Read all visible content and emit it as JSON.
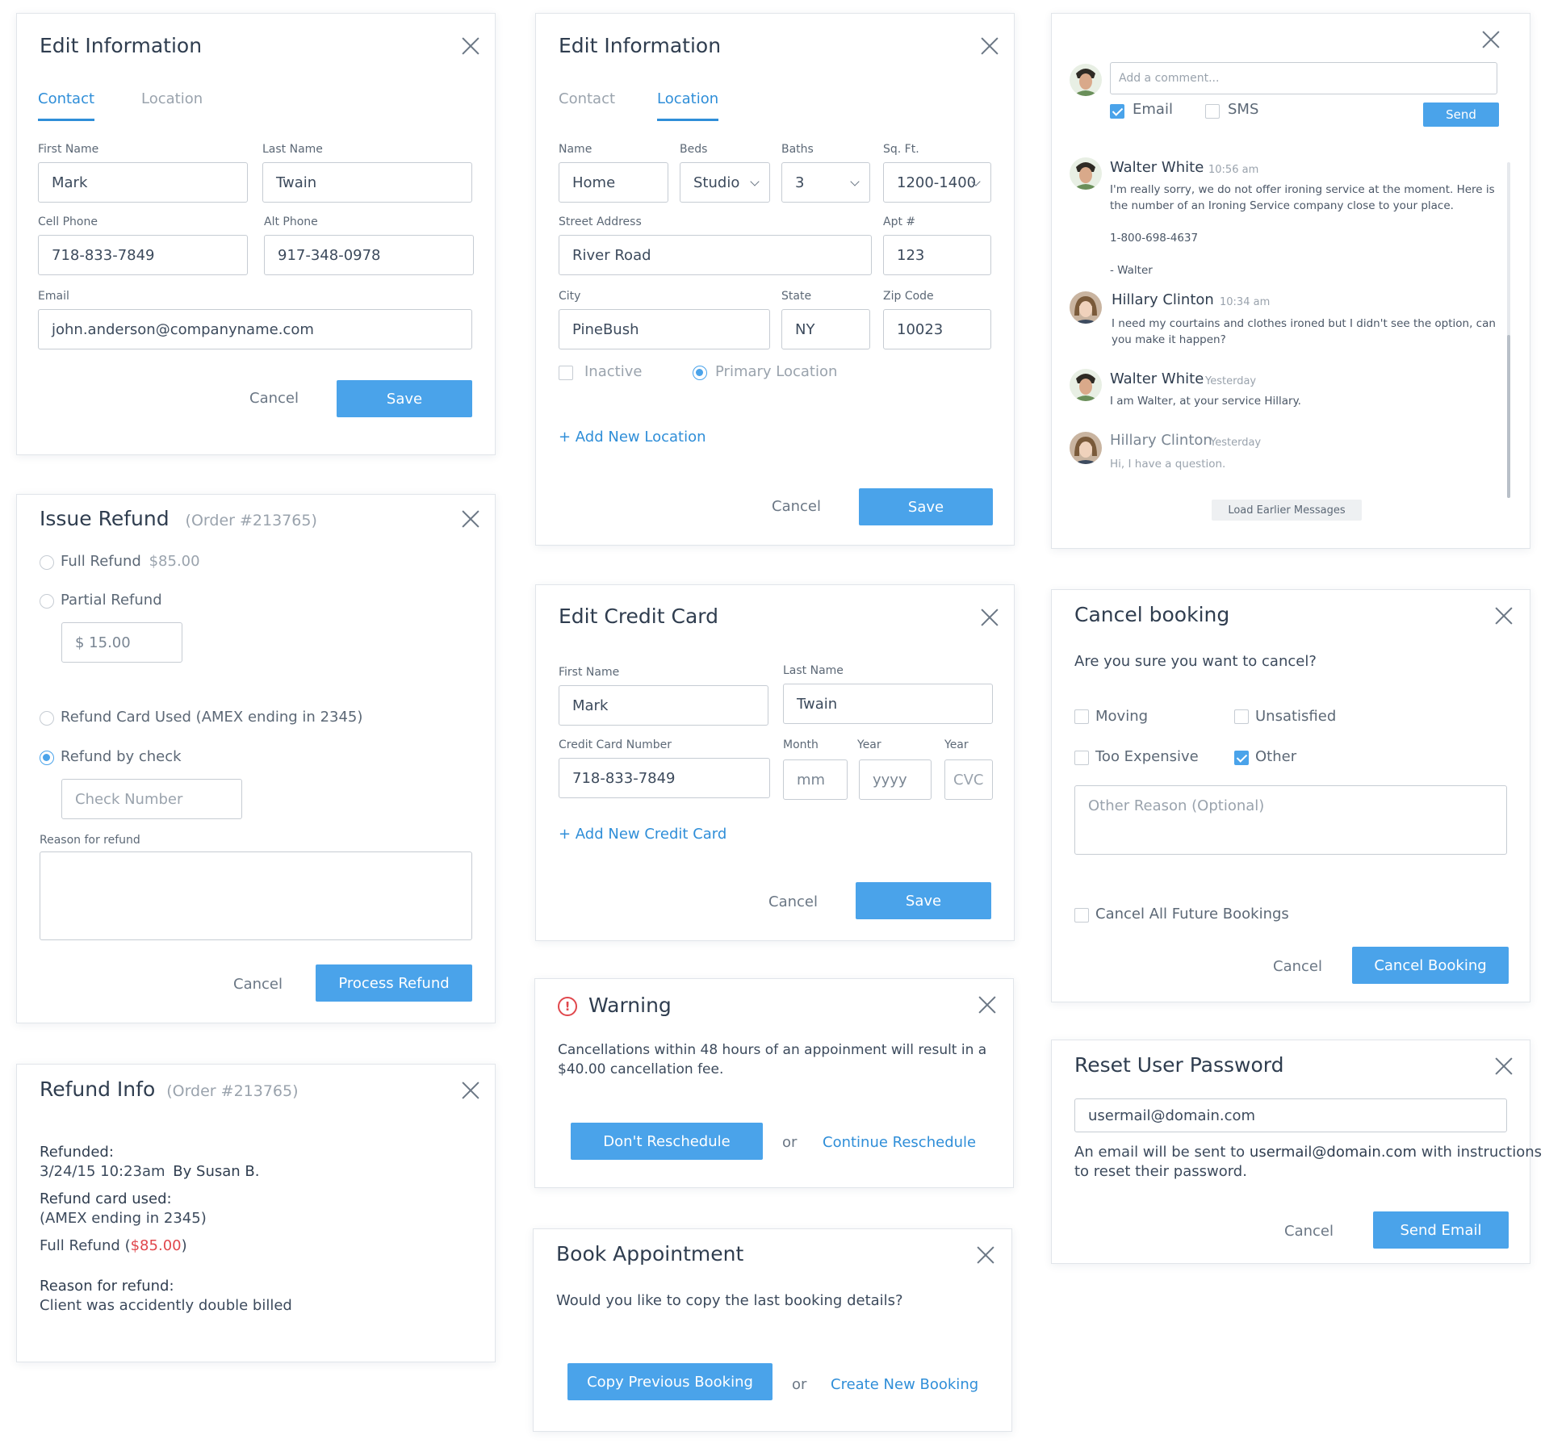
{
  "edit_contact": {
    "title": "Edit Information",
    "tabs": [
      "Contact",
      "Location"
    ],
    "first_name_label": "First Name",
    "first_name": "Mark",
    "last_name_label": "Last Name",
    "last_name": "Twain",
    "cell_label": "Cell Phone",
    "cell": "718-833-7849",
    "alt_label": "Alt Phone",
    "alt": "917-348-0978",
    "email_label": "Email",
    "email": "john.anderson@companyname.com",
    "cancel": "Cancel",
    "save": "Save"
  },
  "edit_location": {
    "title": "Edit Information",
    "tabs": [
      "Contact",
      "Location"
    ],
    "name_label": "Name",
    "name": "Home",
    "beds_label": "Beds",
    "beds": "Studio",
    "baths_label": "Baths",
    "baths": "3",
    "sqft_label": "Sq. Ft.",
    "sqft": "1200-1400",
    "street_label": "Street Address",
    "street": "River Road",
    "apt_label": "Apt #",
    "apt": "123",
    "city_label": "City",
    "city": "PineBush",
    "state_label": "State",
    "state": "NY",
    "zip_label": "Zip Code",
    "zip": "10023",
    "inactive": "Inactive",
    "primary": "Primary Location",
    "add_location": "+ Add New Location",
    "cancel": "Cancel",
    "save": "Save"
  },
  "comments": {
    "placeholder": "Add a comment...",
    "email": "Email",
    "sms": "SMS",
    "send": "Send",
    "messages": [
      {
        "name": "Walter White",
        "time": "10:56 am",
        "lines": [
          "I'm really sorry, we do not offer ironing service at the moment. Here is the number of an Ironing Service company close to your place.",
          "1-800-698-4637",
          "- Walter"
        ]
      },
      {
        "name": "Hillary Clinton",
        "time": "10:34 am",
        "lines": [
          "I need my courtains and clothes ironed but I didn't see the option, can you make it happen?"
        ]
      },
      {
        "name": "Walter White",
        "time": "Yesterday",
        "lines": [
          "I am Walter, at your service Hillary."
        ]
      },
      {
        "name": "Hillary Clinton",
        "time": "Yesterday",
        "lines": [
          "Hi, I have a question."
        ]
      }
    ],
    "load_earlier": "Load Earlier Messages"
  },
  "refund": {
    "title": "Issue Refund",
    "order": "(Order #213765)",
    "full": "Full Refund",
    "full_amount": "$85.00",
    "partial": "Partial Refund",
    "partial_value": "$ 15.00",
    "card": "Refund Card Used (AMEX ending in 2345)",
    "check": "Refund by check",
    "check_placeholder": "Check Number",
    "reason_label": "Reason for refund",
    "cancel": "Cancel",
    "process": "Process Refund"
  },
  "credit_card": {
    "title": "Edit Credit Card",
    "first_name_label": "First Name",
    "first_name": "Mark",
    "last_name_label": "Last Name",
    "last_name": "Twain",
    "number_label": "Credit Card Number",
    "number": "718-833-7849",
    "month_label": "Month",
    "month": "mm",
    "year_label": "Year",
    "year": "yyyy",
    "cvc_label": "Year",
    "cvc": "CVC",
    "add_card": "+ Add New Credit Card",
    "cancel": "Cancel",
    "save": "Save"
  },
  "cancel_booking": {
    "title": "Cancel booking",
    "question": "Are you sure you want to cancel?",
    "reasons": [
      "Moving",
      "Unsatisfied",
      "Too Expensive",
      "Other"
    ],
    "other_placeholder": "Other Reason (Optional)",
    "future": "Cancel All Future Bookings",
    "cancel": "Cancel",
    "confirm": "Cancel Booking"
  },
  "refund_info": {
    "title": "Refund Info",
    "order": "(Order #213765)",
    "refunded_label": "Refunded:",
    "refunded_date": "3/24/15 10:23am",
    "refunded_by": "By Susan B.",
    "card_label": "Refund card used:",
    "card_value": "(AMEX ending in 2345)",
    "full_label": "Full Refund (",
    "full_amount": "$85.00",
    "full_close": ")",
    "reason_label": "Reason for refund:",
    "reason_value": "Client was accidently double billed"
  },
  "warning": {
    "title": "Warning",
    "message_1": "Cancellations within 48 hours of an appoinment will result in a",
    "message_2": "$40.00 cancellation fee.",
    "dont": "Don't Reschedule",
    "or": "or",
    "continue": "Continue Reschedule"
  },
  "reset_password": {
    "title": "Reset User Password",
    "email": "usermail@domain.com",
    "note_1": "An email will be sent to ",
    "note_email": "usermail@domain.com",
    "note_2": " with instructions",
    "note_3": "to reset their password.",
    "cancel": "Cancel",
    "send": "Send Email"
  },
  "book": {
    "title": "Book Appointment",
    "question": "Would you like to copy the last booking details?",
    "copy": "Copy Previous Booking",
    "or": "or",
    "create": "Create New Booking"
  },
  "colors": {
    "accent": "#4aa3ea",
    "link": "#2f8ed8",
    "danger": "#e0474c"
  }
}
